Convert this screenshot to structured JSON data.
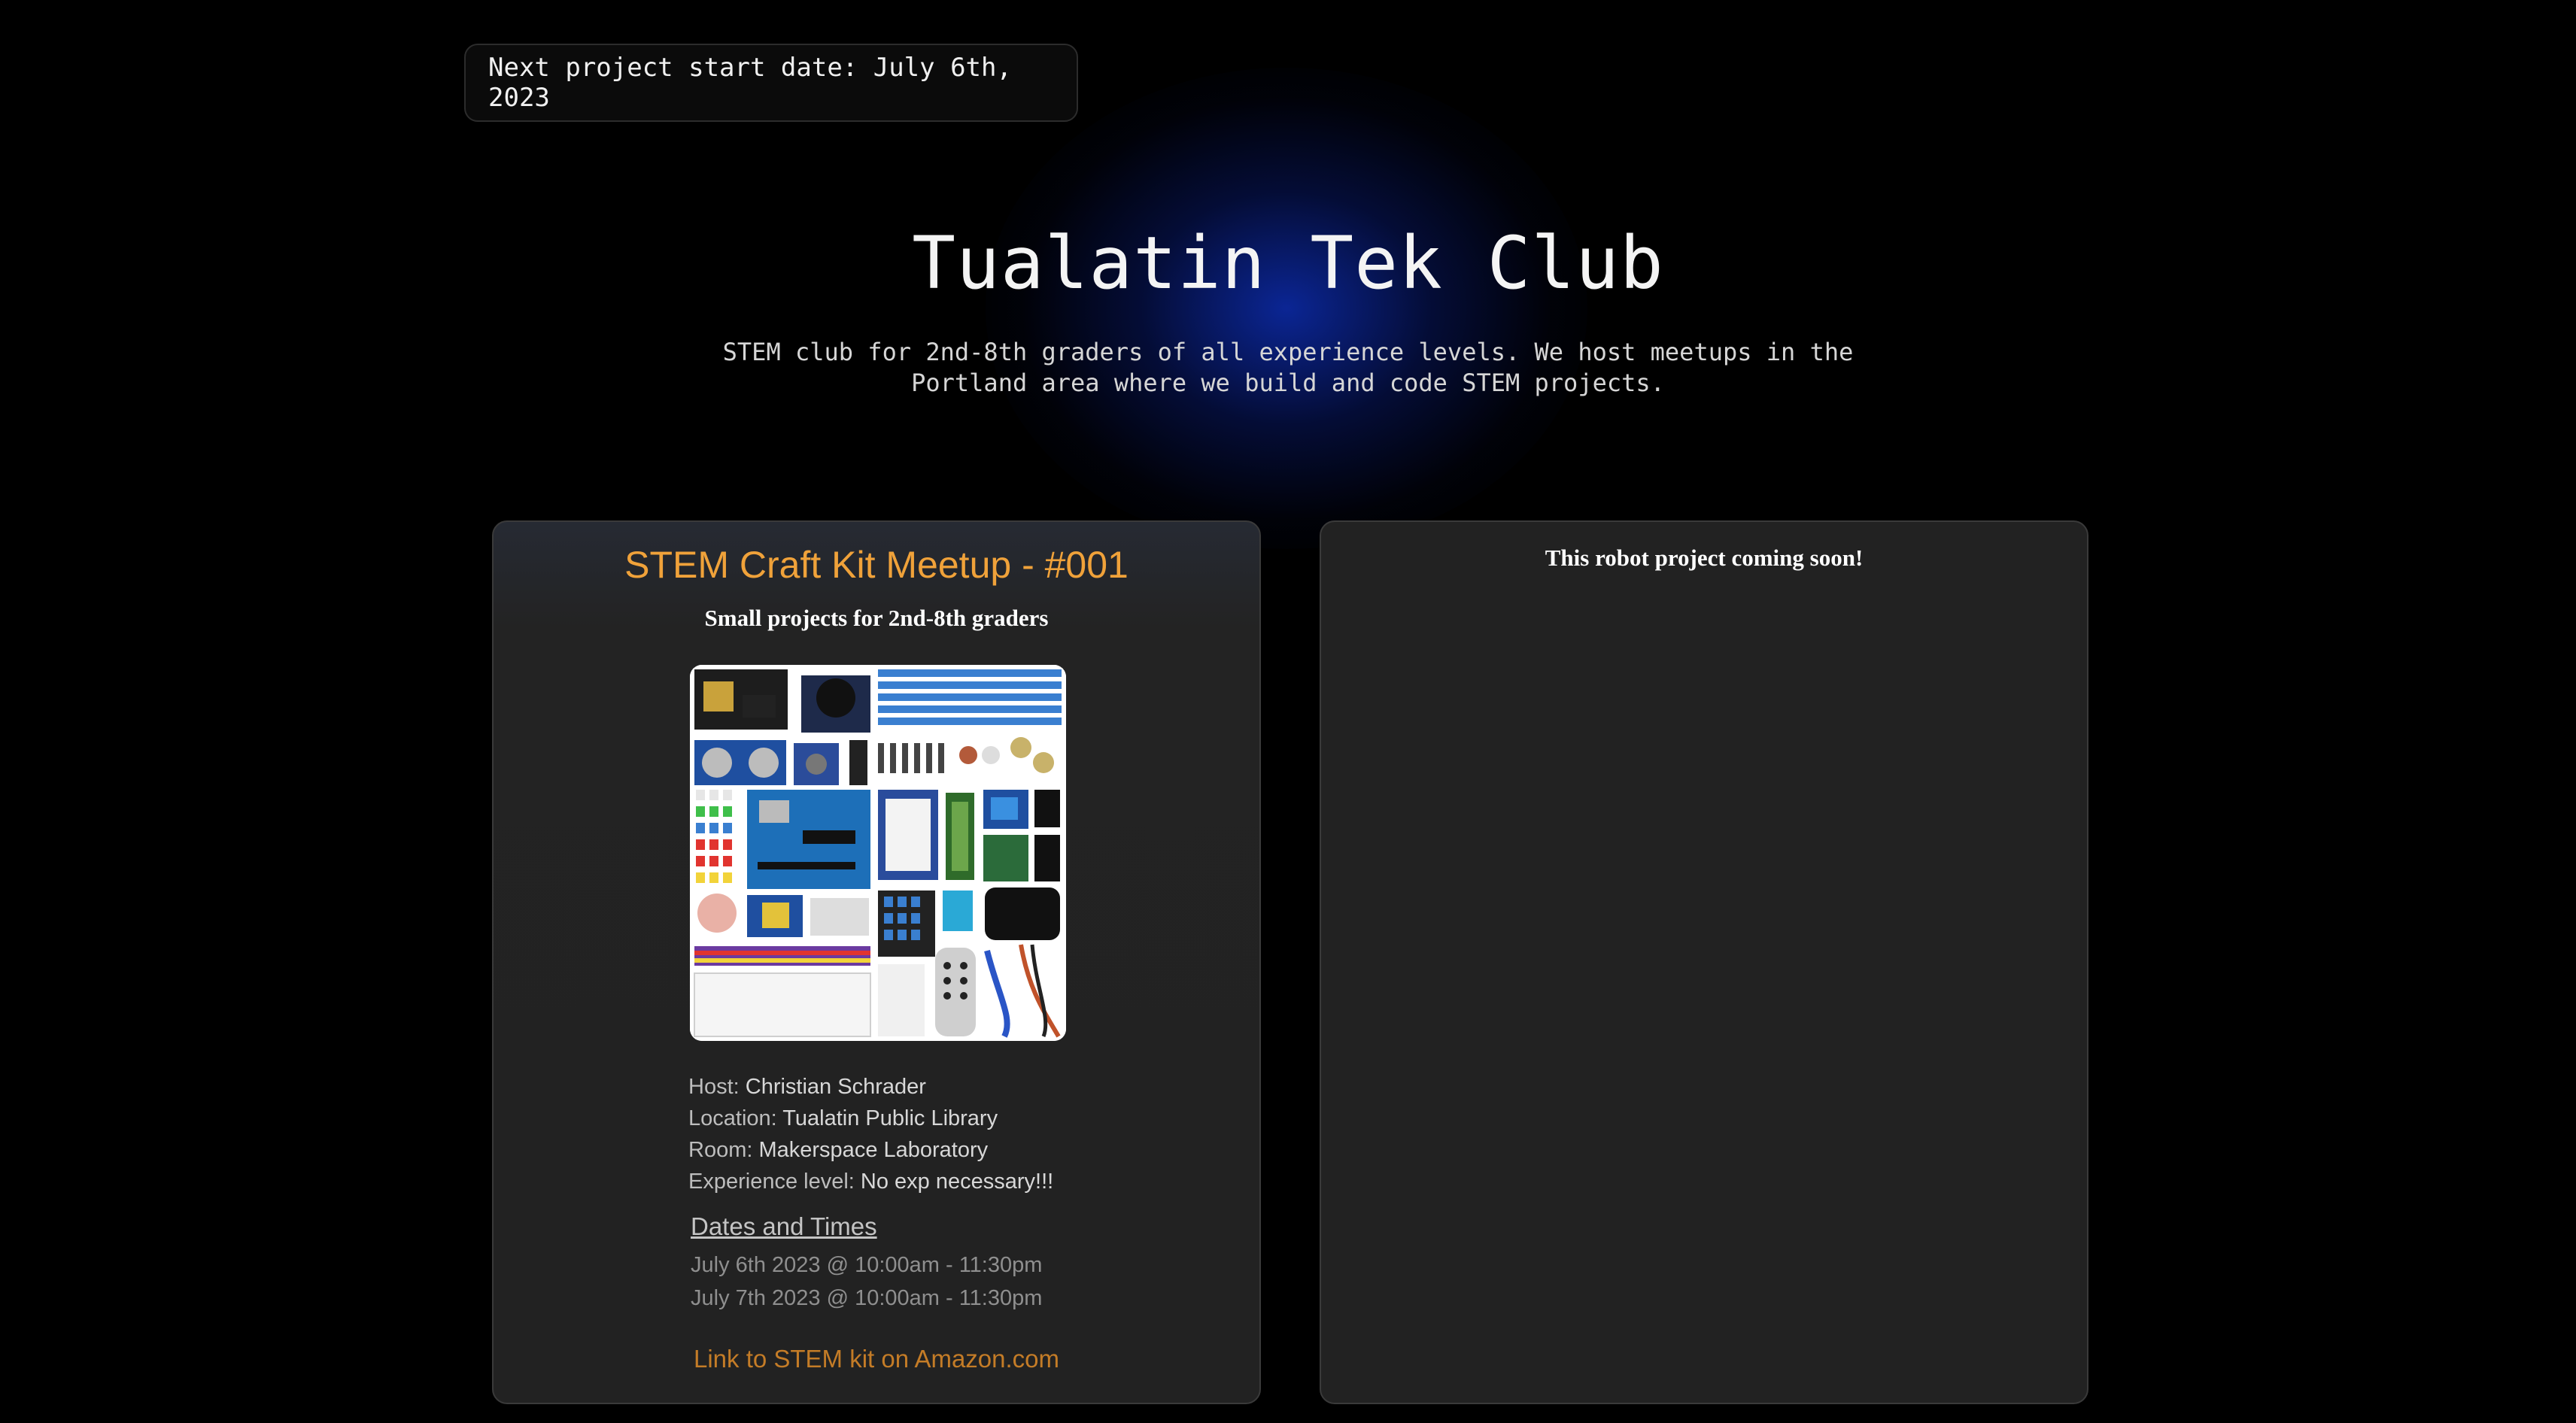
{
  "banner": {
    "text": "Next project start date: July 6th, 2023"
  },
  "hero": {
    "title": "Tualatin Tek Club",
    "subtitle": "STEM club for 2nd-8th graders of all experience levels. We host meetups in the Portland area where we build and code STEM projects."
  },
  "cards": [
    {
      "title": "STEM Craft Kit Meetup - #001",
      "subtitle": "Small projects for 2nd-8th graders",
      "image": "stem-kit-components-photo",
      "details": [
        {
          "label": "Host:",
          "value": "Christian Schrader"
        },
        {
          "label": "Location:",
          "value": "Tualatin Public Library"
        },
        {
          "label": "Room:",
          "value": "Makerspace Laboratory"
        },
        {
          "label": "Experience level:",
          "value": "No exp necessary!!!"
        }
      ],
      "dates_heading": "Dates and Times",
      "dates": [
        "July 6th 2023 @ 10:00am - 11:30pm",
        "July 7th 2023 @ 10:00am - 11:30pm"
      ],
      "link_text": "Link to STEM kit on Amazon.com"
    },
    {
      "title": "This robot project coming soon!"
    }
  ],
  "colors": {
    "background": "#000000",
    "card_background": "#222222",
    "accent_orange": "#f0a23a",
    "link_orange": "#c47c27",
    "glow_blue": "#0e30be"
  }
}
